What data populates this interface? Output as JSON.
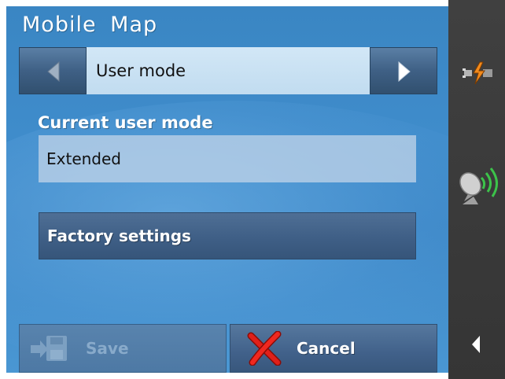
{
  "app": {
    "title": "Mobile Map"
  },
  "selector": {
    "value": "User mode",
    "prev_icon": "chevron-left-icon",
    "next_icon": "chevron-right-icon"
  },
  "current_mode": {
    "label": "Current user mode",
    "value": "Extended"
  },
  "factory_settings": {
    "label": "Factory settings"
  },
  "footer": {
    "save_label": "Save",
    "save_icon": "save-disk-icon",
    "save_enabled": false,
    "cancel_label": "Cancel",
    "cancel_icon": "red-x-icon"
  },
  "sidebar": {
    "icons": [
      "power-plug-icon",
      "gps-satellite-icon",
      "collapse-arrow-icon"
    ]
  },
  "colors": {
    "background": "#3f8ccb",
    "sidebar": "#3a3a3a",
    "cancel_x": "#e0201a",
    "power_plug": "#f28a1c",
    "gps_signal": "#3cc34a"
  }
}
